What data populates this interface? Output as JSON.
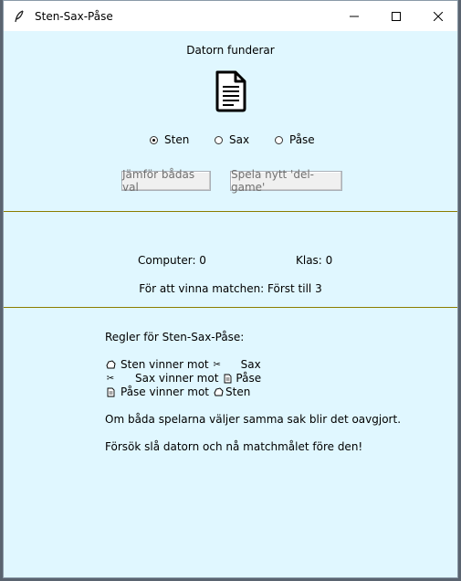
{
  "window": {
    "title": "Sten-Sax-Påse"
  },
  "status": "Datorn funderar",
  "computer_choice_icon": "document-icon",
  "choices": [
    {
      "label": "Sten",
      "selected": true
    },
    {
      "label": "Sax",
      "selected": false
    },
    {
      "label": "Påse",
      "selected": false
    }
  ],
  "buttons": {
    "compare": "Jämför bådas val",
    "new_game": "Spela nytt 'del-game'"
  },
  "score": {
    "computer": "Computer: 0",
    "player": "Klas: 0"
  },
  "goal": "För att vinna matchen: Först till 3",
  "rules": {
    "heading": "Regler för Sten-Sax-Påse:",
    "rule1": {
      "a": "Sten vinner mot",
      "b": "Sax"
    },
    "rule2": {
      "a": "Sax vinner mot",
      "b": "Påse"
    },
    "rule3": {
      "a": "Påse vinner mot",
      "b": "Sten"
    },
    "tie": "Om båda spelarna väljer samma sak blir det oavgjort.",
    "goal": "Försök slå datorn och nå matchmålet före den!"
  },
  "colors": {
    "background": "#e0f7ff",
    "separator": "#8b7d00"
  }
}
